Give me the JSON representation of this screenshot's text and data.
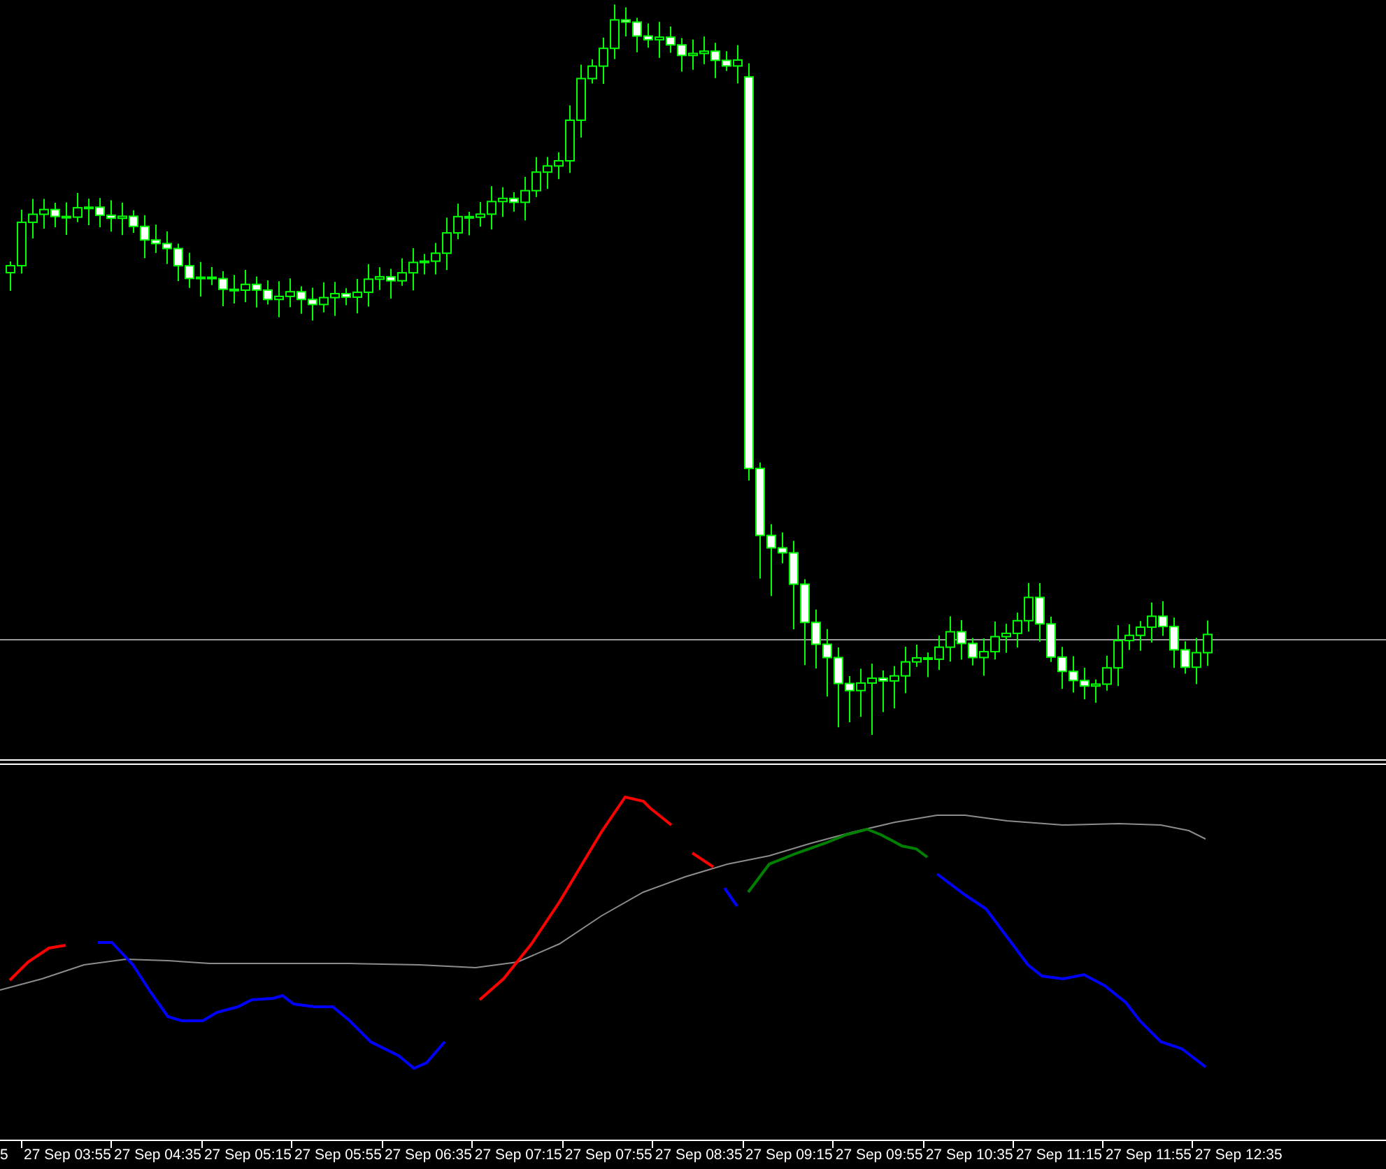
{
  "x_axis": {
    "labels": [
      "5",
      "27 Sep 03:55",
      "27 Sep 04:35",
      "27 Sep 05:15",
      "27 Sep 05:55",
      "27 Sep 06:35",
      "27 Sep 07:15",
      "27 Sep 07:55",
      "27 Sep 08:35",
      "27 Sep 09:15",
      "27 Sep 09:55",
      "27 Sep 10:35",
      "27 Sep 11:15",
      "27 Sep 11:55",
      "27 Sep 12:35"
    ]
  }
}
